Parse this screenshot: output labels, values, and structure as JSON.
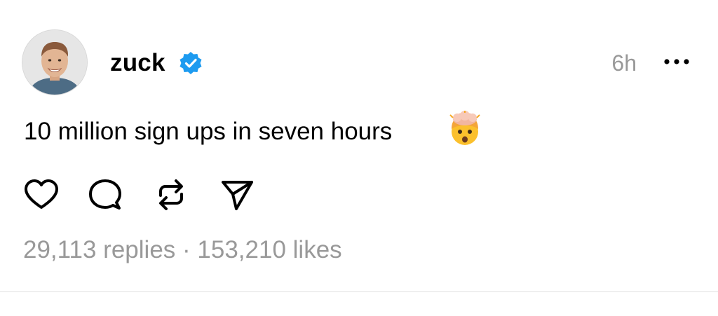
{
  "post": {
    "author": {
      "username": "zuck",
      "verified": true,
      "avatar_icon": "profile-photo"
    },
    "timestamp": "6h",
    "more_icon": "more-options-icon",
    "text": "10 million sign ups in seven hours",
    "emoji": "exploding-head-emoji",
    "actions": [
      {
        "name": "like",
        "icon": "heart-icon"
      },
      {
        "name": "reply",
        "icon": "comment-icon"
      },
      {
        "name": "repost",
        "icon": "repost-icon"
      },
      {
        "name": "share",
        "icon": "send-icon"
      }
    ],
    "stats": {
      "replies": "29,113 replies",
      "separator": "·",
      "likes": "153,210 likes"
    }
  },
  "colors": {
    "text": "#000000",
    "muted": "#999999",
    "verified_badge": "#1d9bf0",
    "divider": "#e2e2e2"
  }
}
